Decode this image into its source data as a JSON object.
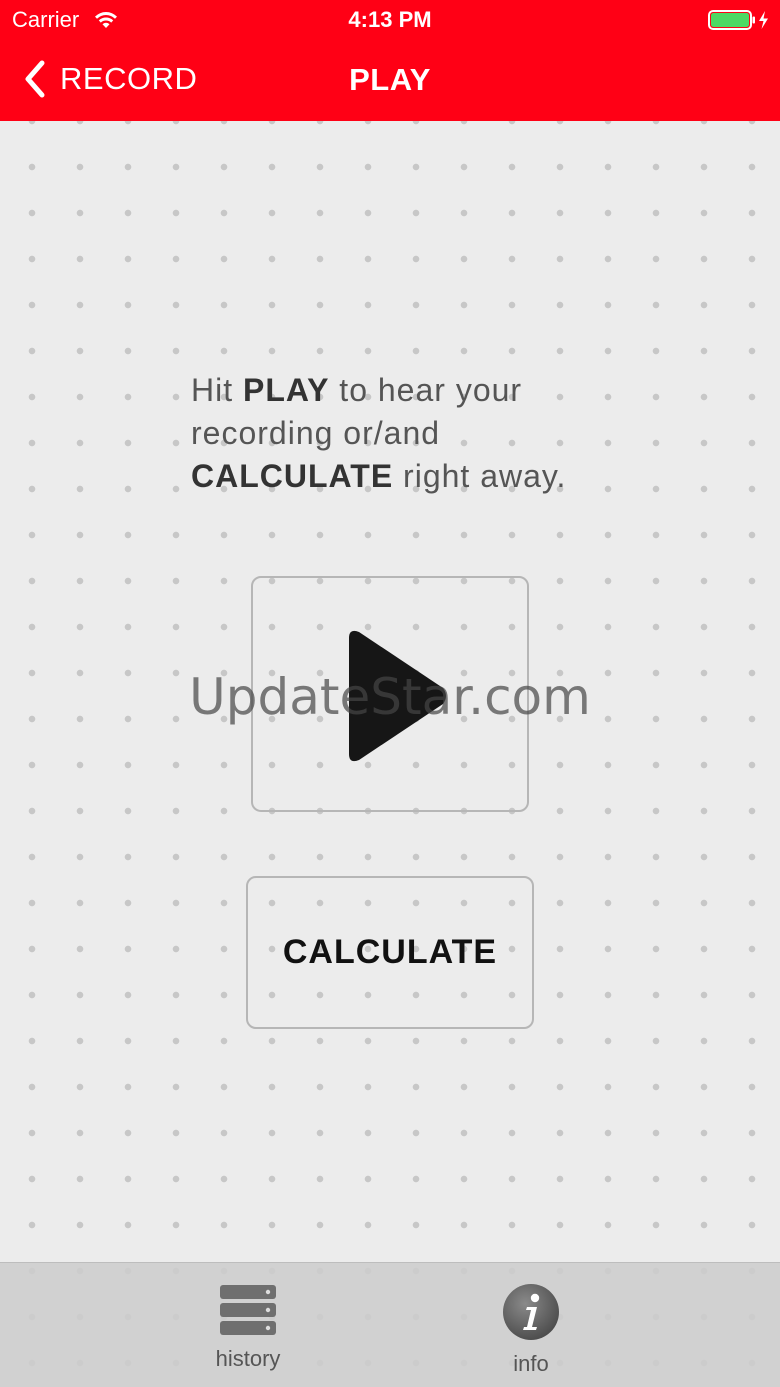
{
  "status_bar": {
    "carrier": "Carrier",
    "time": "4:13 PM",
    "wifi_icon": "wifi-icon",
    "battery_icon": "battery-charging-icon",
    "battery_color": "#4cd964"
  },
  "nav_bar": {
    "back_label": "RECORD",
    "title": "PLAY",
    "background_color": "#ff0015"
  },
  "main": {
    "instruction_line1_pre": "Hit ",
    "instruction_line1_bold": "PLAY",
    "instruction_line1_post": " to hear your",
    "instruction_line2": "recording or/and",
    "instruction_line3_bold": "CALCULATE",
    "instruction_line3_post": " right away.",
    "play_icon": "play-icon",
    "calculate_label": "CALCULATE",
    "watermark": "UpdateStar.com"
  },
  "tab_bar": {
    "tabs": [
      {
        "label": "history",
        "icon": "server-stack-icon"
      },
      {
        "label": "info",
        "icon": "info-icon"
      }
    ]
  }
}
